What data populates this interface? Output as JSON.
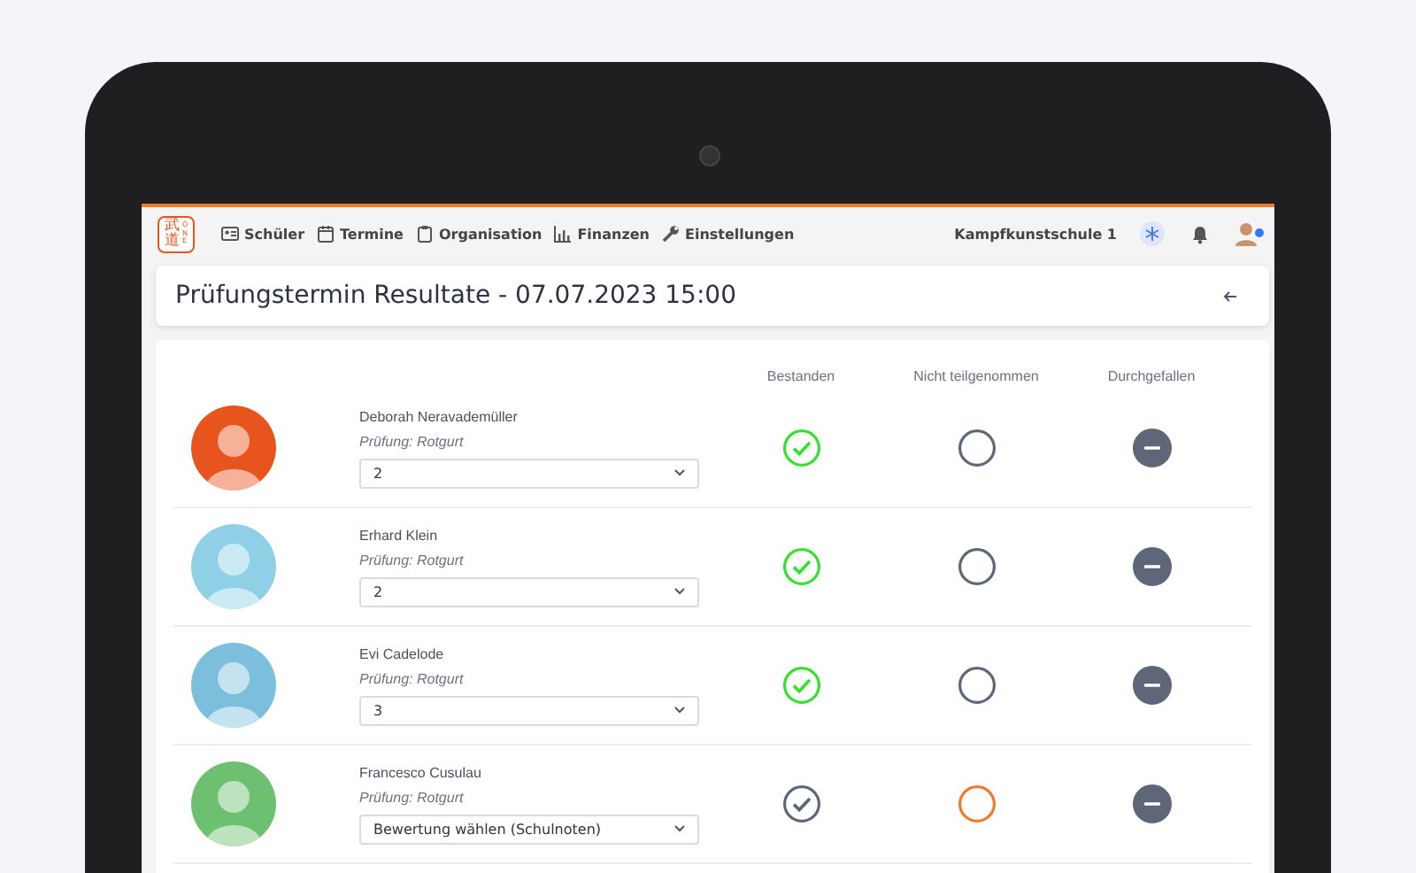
{
  "logo": {
    "glyphs": "武道",
    "word": "ONE"
  },
  "nav": [
    {
      "label": "Schüler"
    },
    {
      "label": "Termine"
    },
    {
      "label": "Organisation"
    },
    {
      "label": "Finanzen"
    },
    {
      "label": "Einstellungen"
    }
  ],
  "school": "Kampfkunstschule 1",
  "user": {
    "online": true
  },
  "page_title": "Prüfungstermin Resultate - 07.07.2023 15:00",
  "columns": [
    "Bestanden",
    "Nicht teilgenommen",
    "Durchgefallen"
  ],
  "students": [
    {
      "name": "Deborah Neravademüller",
      "exam": "Prüfung: Rotgurt",
      "grade": "2",
      "results": [
        {
          "kind": "passed",
          "selected": true
        },
        {
          "kind": "absent",
          "selected": false
        },
        {
          "kind": "failed",
          "selected": false
        }
      ]
    },
    {
      "name": "Erhard Klein",
      "exam": "Prüfung: Rotgurt",
      "grade": "2",
      "results": [
        {
          "kind": "passed",
          "selected": true
        },
        {
          "kind": "absent",
          "selected": false
        },
        {
          "kind": "failed",
          "selected": false
        }
      ]
    },
    {
      "name": "Evi Cadelode",
      "exam": "Prüfung: Rotgurt",
      "grade": "3",
      "results": [
        {
          "kind": "passed",
          "selected": true
        },
        {
          "kind": "absent",
          "selected": false
        },
        {
          "kind": "failed",
          "selected": false
        }
      ]
    },
    {
      "name": "Francesco Cusulau",
      "exam": "Prüfung: Rotgurt",
      "grade": "Bewertung wählen (Schulnoten)",
      "results": [
        {
          "kind": "passed",
          "selected": false
        },
        {
          "kind": "absent",
          "selected": true
        },
        {
          "kind": "failed",
          "selected": false
        }
      ]
    }
  ]
}
